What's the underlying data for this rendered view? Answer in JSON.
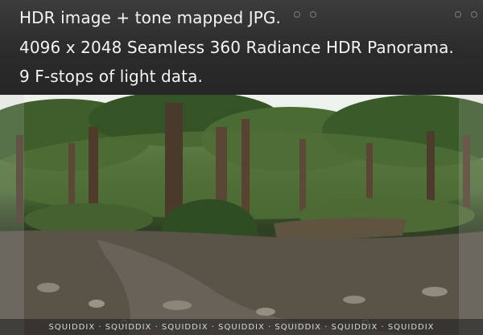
{
  "banner": {
    "line1": "HDR image + tone mapped JPG.",
    "line2": "4096 x 2048  Seamless 360 Radiance HDR Panorama.",
    "line3": "9 F-stops of light data."
  },
  "watermark": {
    "strip": "SQUIDDIX  ·  SQUIDDIX  ·  SQUIDDIX  ·  SQUIDDIX  ·  SQUIDDIX  ·  SQUIDDIX  ·  SQUIDDIX"
  },
  "photo": {
    "subject": "forest-panorama",
    "colors": {
      "canopy": "#3d5a2a",
      "trunk": "#4a3a2c",
      "ground": "#5d564a",
      "sky": "#f1f4ef"
    }
  }
}
